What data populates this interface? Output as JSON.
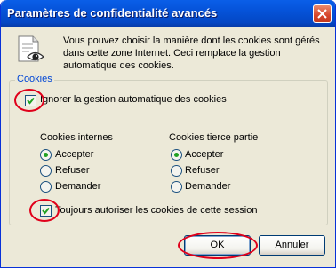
{
  "window": {
    "title": "Paramètres de confidentialité avancés"
  },
  "intro_text": "Vous pouvez choisir la manière dont les cookies sont gérés dans cette zone Internet. Ceci remplace la gestion automatique des cookies.",
  "cookies_group": {
    "legend": "Cookies",
    "override_label": "Ignorer la gestion automatique des cookies",
    "override_checked": true,
    "first_party": {
      "heading": "Cookies internes",
      "options": [
        "Accepter",
        "Refuser",
        "Demander"
      ],
      "selected": "Accepter"
    },
    "third_party": {
      "heading": "Cookies tierce partie",
      "options": [
        "Accepter",
        "Refuser",
        "Demander"
      ],
      "selected": "Accepter"
    },
    "session_label": "Toujours autoriser les cookies de cette session",
    "session_checked": true
  },
  "buttons": {
    "ok": "OK",
    "cancel": "Annuler"
  },
  "colors": {
    "title_bar": "#0553d9",
    "dialog_bg": "#ece9d8",
    "legend_text": "#0046d5",
    "highlight_oval": "#e0001a",
    "check_mark": "#21a121"
  }
}
